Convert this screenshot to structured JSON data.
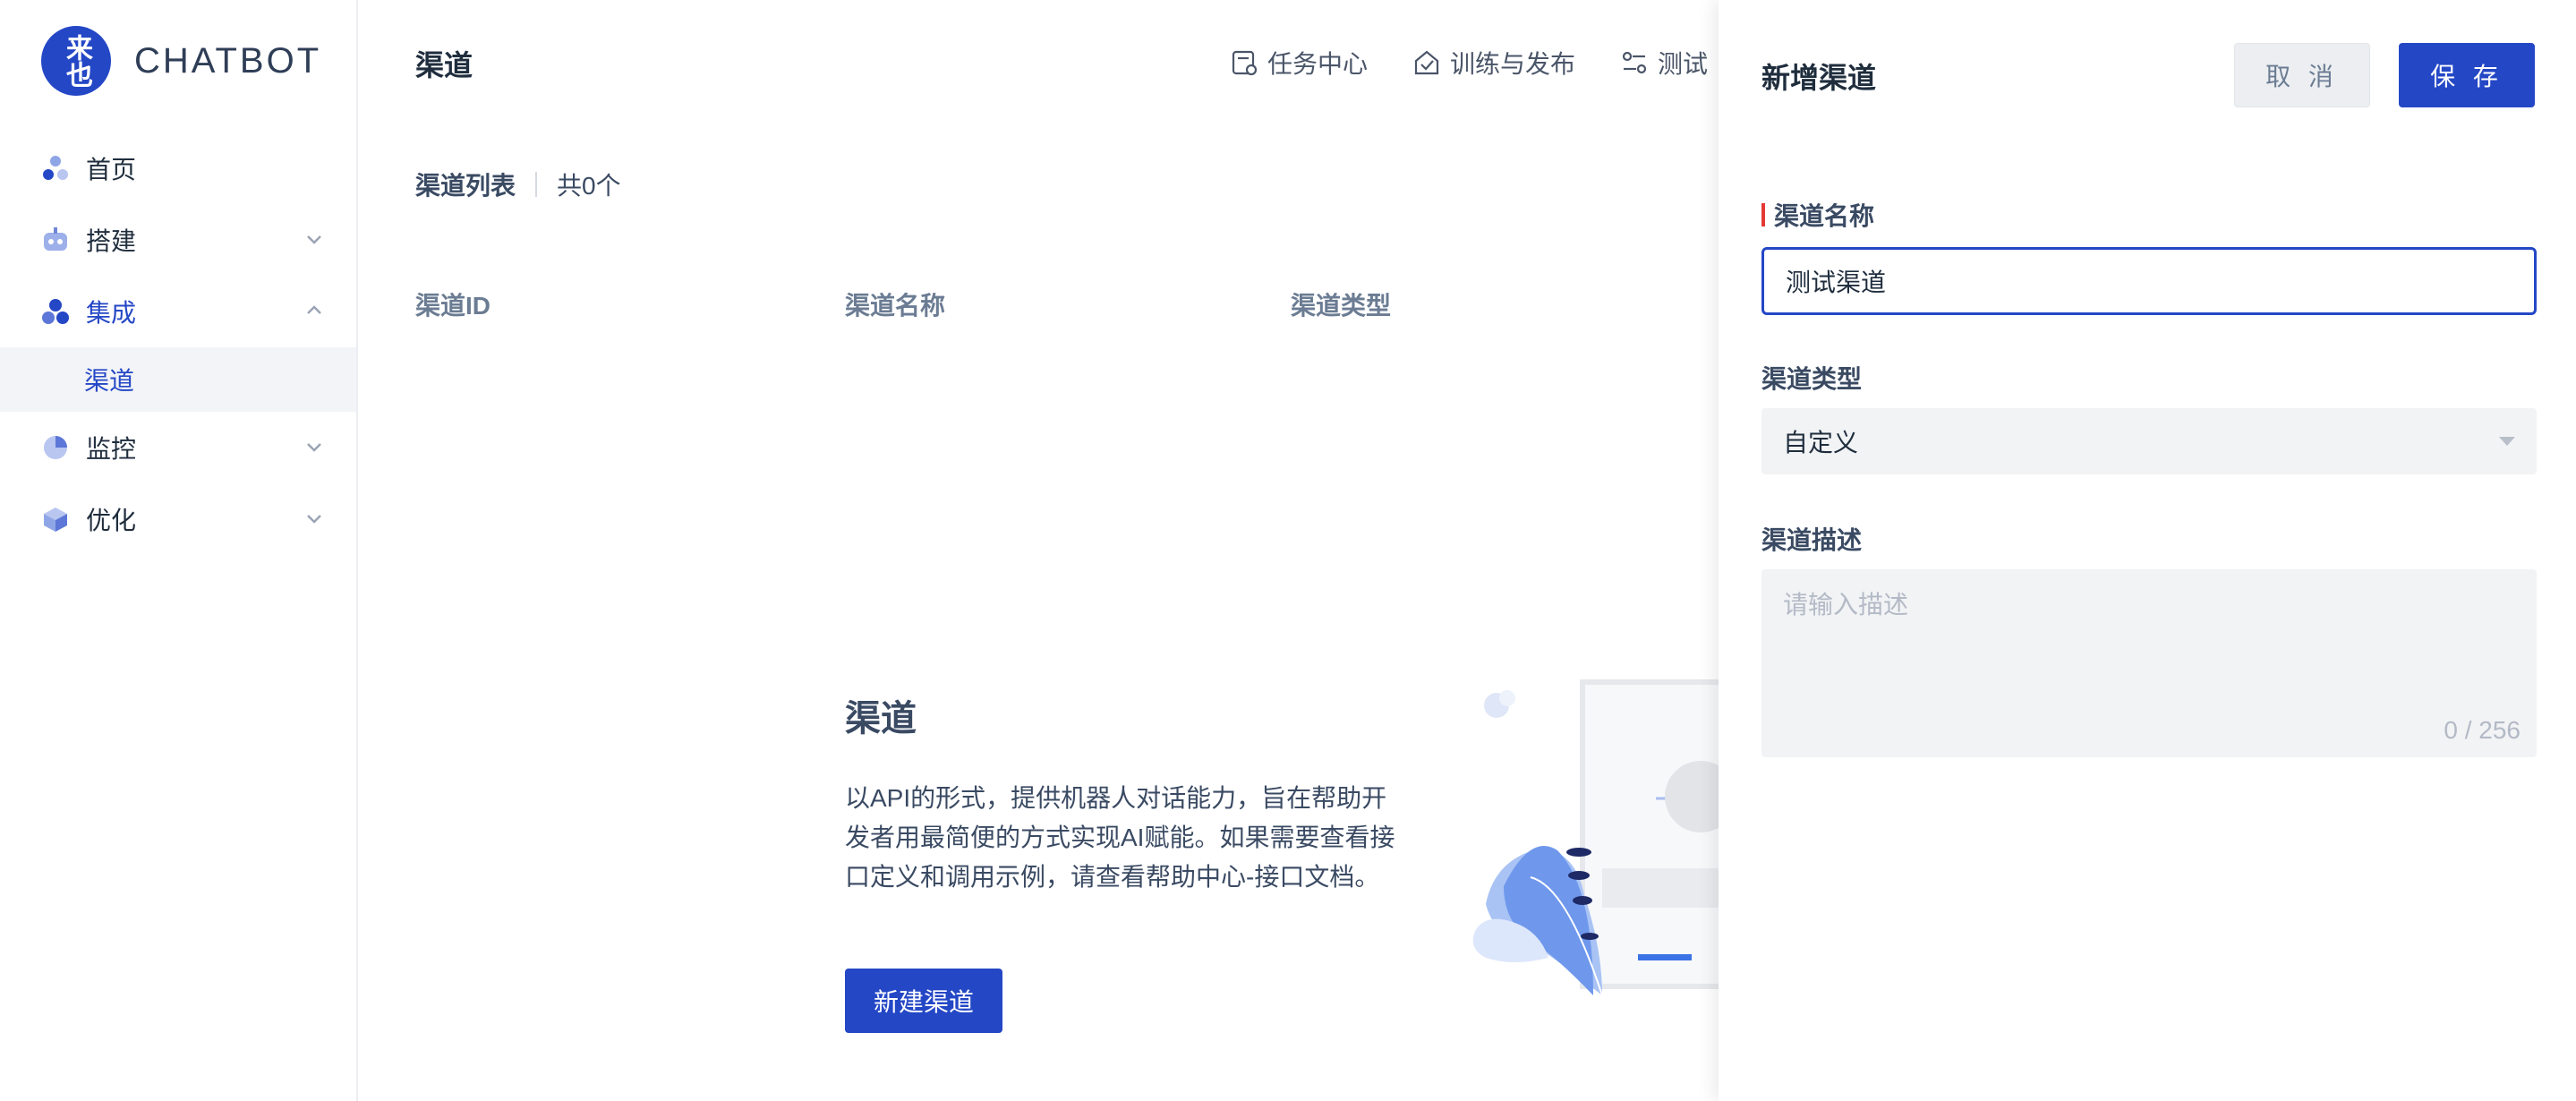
{
  "sidebar": {
    "logo_glyph": "来也",
    "logo_text": "CHATBOT",
    "items": [
      {
        "label": "首页",
        "icon": "home-nodes-icon"
      },
      {
        "label": "搭建",
        "icon": "robot-icon"
      },
      {
        "label": "集成",
        "icon": "integration-icon",
        "active": true
      },
      {
        "label": "渠道",
        "sub": true,
        "active": true
      },
      {
        "label": "监控",
        "icon": "pie-chart-icon"
      },
      {
        "label": "优化",
        "icon": "cube-icon"
      }
    ]
  },
  "header": {
    "title": "渠道",
    "links": [
      {
        "label": "任务中心",
        "icon": "task-icon"
      },
      {
        "label": "训练与发布",
        "icon": "publish-icon"
      },
      {
        "label": "测试",
        "icon": "test-icon"
      }
    ]
  },
  "list": {
    "title": "渠道列表",
    "count": "共0个",
    "columns": [
      "渠道ID",
      "渠道名称",
      "渠道类型"
    ]
  },
  "empty": {
    "title": "渠道",
    "description": "以API的形式，提供机器人对话能力，旨在帮助开发者用最简便的方式实现AI赋能。如果需要查看接口定义和调用示例，请查看帮助中心-接口文档。",
    "button": "新建渠道"
  },
  "drawer": {
    "title": "新增渠道",
    "cancel": "取 消",
    "save": "保 存",
    "name_label": "渠道名称",
    "name_value": "测试渠道",
    "type_label": "渠道类型",
    "type_value": "自定义",
    "desc_label": "渠道描述",
    "desc_placeholder": "请输入描述",
    "desc_counter": "0 / 256"
  },
  "colors": {
    "primary": "#2447c6",
    "required": "#e53935",
    "muted": "#6b7c93"
  }
}
